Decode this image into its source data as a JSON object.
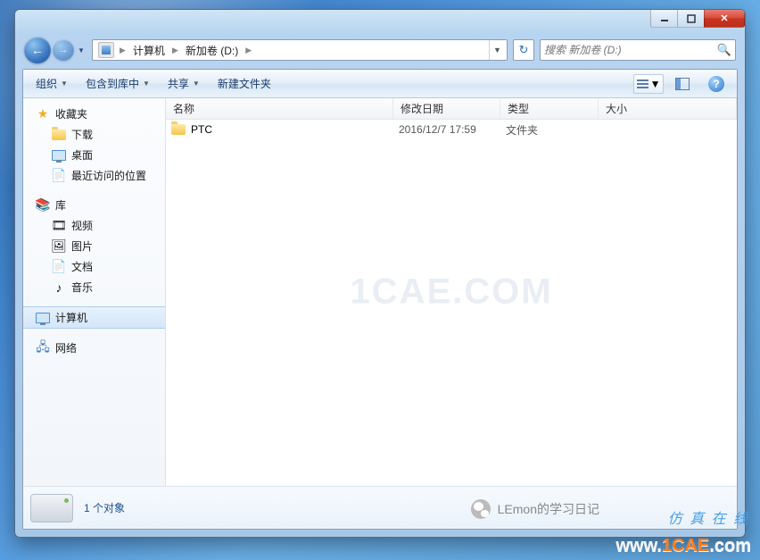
{
  "breadcrumbs": {
    "root": "计算机",
    "drive": "新加卷 (D:)"
  },
  "search": {
    "placeholder": "搜索 新加卷 (D:)"
  },
  "toolbar": {
    "organize": "组织",
    "include": "包含到库中",
    "share": "共享",
    "new_folder": "新建文件夹"
  },
  "sidebar": {
    "favorites": "收藏夹",
    "favorites_items": {
      "downloads": "下载",
      "desktop": "桌面",
      "recent": "最近访问的位置"
    },
    "libraries": "库",
    "libraries_items": {
      "videos": "视频",
      "pictures": "图片",
      "documents": "文档",
      "music": "音乐"
    },
    "computer": "计算机",
    "network": "网络"
  },
  "columns": {
    "name": "名称",
    "modified": "修改日期",
    "type": "类型",
    "size": "大小"
  },
  "rows": [
    {
      "name": "PTC",
      "modified": "2016/12/7 17:59",
      "type": "文件夹",
      "size": ""
    }
  ],
  "details": {
    "count": "1 个对象"
  },
  "watermarks": {
    "center": "1CAE.COM",
    "wechat": "LEmon的学习日记",
    "tag": "仿 真 在 线",
    "site_a": "www.",
    "site_b": "1CAE",
    "site_c": ".com"
  }
}
